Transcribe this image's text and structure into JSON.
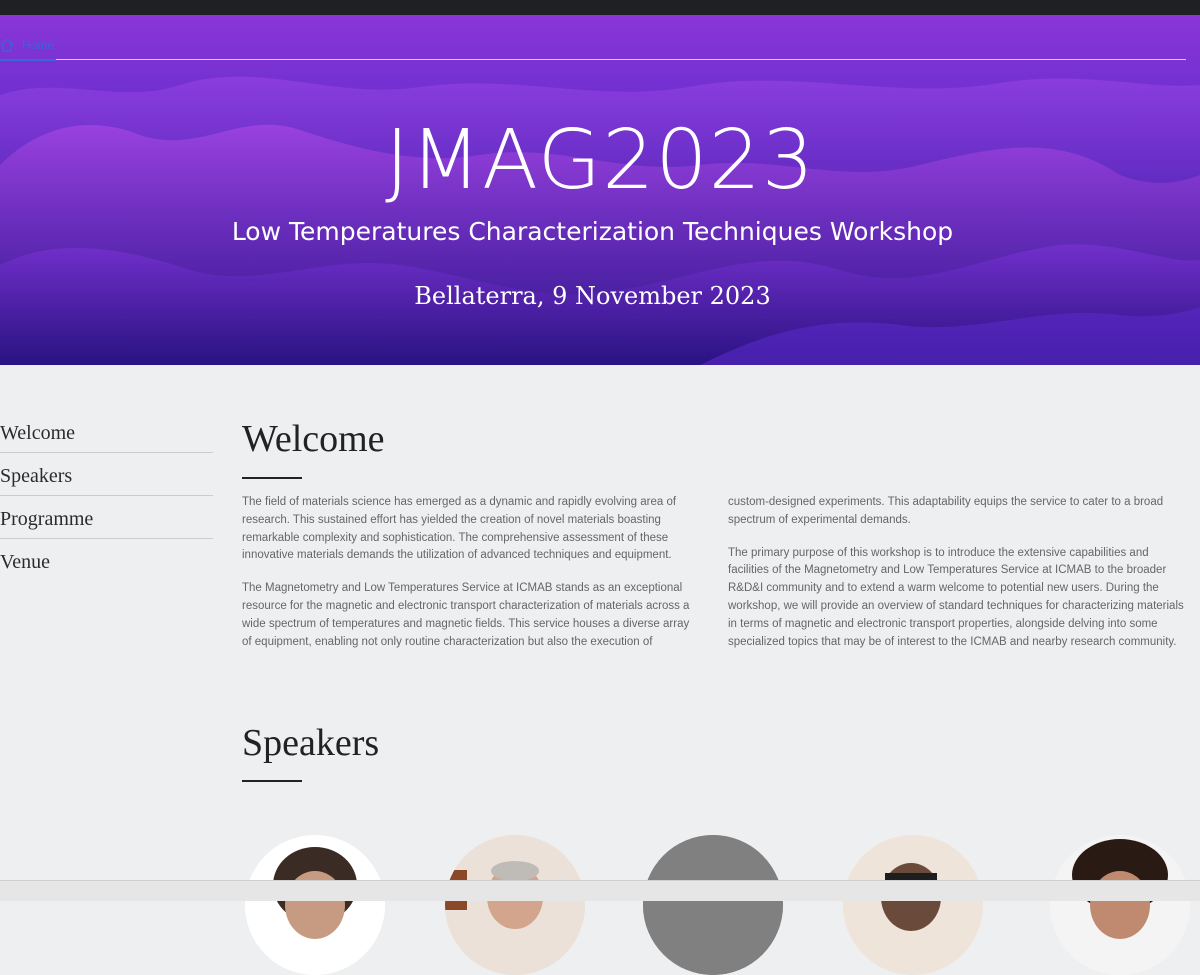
{
  "nav": {
    "home_label": "Home"
  },
  "hero": {
    "title": "JMAG2023",
    "subtitle": "Low Temperatures Characterization Techniques Workshop",
    "date": "Bellaterra, 9 November 2023"
  },
  "sidebar": {
    "items": [
      {
        "label": "Welcome"
      },
      {
        "label": "Speakers"
      },
      {
        "label": "Programme"
      },
      {
        "label": "Venue"
      }
    ]
  },
  "welcome": {
    "title": "Welcome",
    "paragraphs": [
      "The field of materials science has emerged as a dynamic and rapidly evolving area of research. This sustained effort has yielded the creation of novel materials boasting remarkable complexity and sophistication. The comprehensive assessment of these innovative materials demands the utilization of advanced techniques and equipment.",
      "The Magnetometry and Low Temperatures Service at ICMAB stands as an exceptional resource for the magnetic and electronic transport characterization of materials across a wide spectrum of temperatures and magnetic fields. This service houses a diverse array of equipment, enabling not only routine characterization but also the execution of",
      "custom-designed experiments. This adaptability equips the service to cater to a broad spectrum of experimental demands.",
      "The primary purpose of this workshop is to introduce the extensive capabilities and facilities of the Magnetometry and Low Temperatures Service at ICMAB to the broader R&D&I community and to extend a warm welcome to potential new users. During the workshop, we will provide an overview of standard techniques for characterizing materials in terms of magnetic and electronic transport properties, alongside delving into some specialized topics that may be of interest to the ICMAB and nearby research community."
    ]
  },
  "speakers": {
    "title": "Speakers",
    "avatars": [
      {
        "icon": "speaker-photo"
      },
      {
        "icon": "speaker-photo"
      },
      {
        "icon": "placeholder-avatar"
      },
      {
        "icon": "speaker-photo"
      },
      {
        "icon": "speaker-photo"
      }
    ]
  },
  "colors": {
    "hero_top": "#8a36d8",
    "hero_bottom": "#3a1a9a",
    "link": "#3b64d9",
    "page_bg": "#eeeff1"
  }
}
